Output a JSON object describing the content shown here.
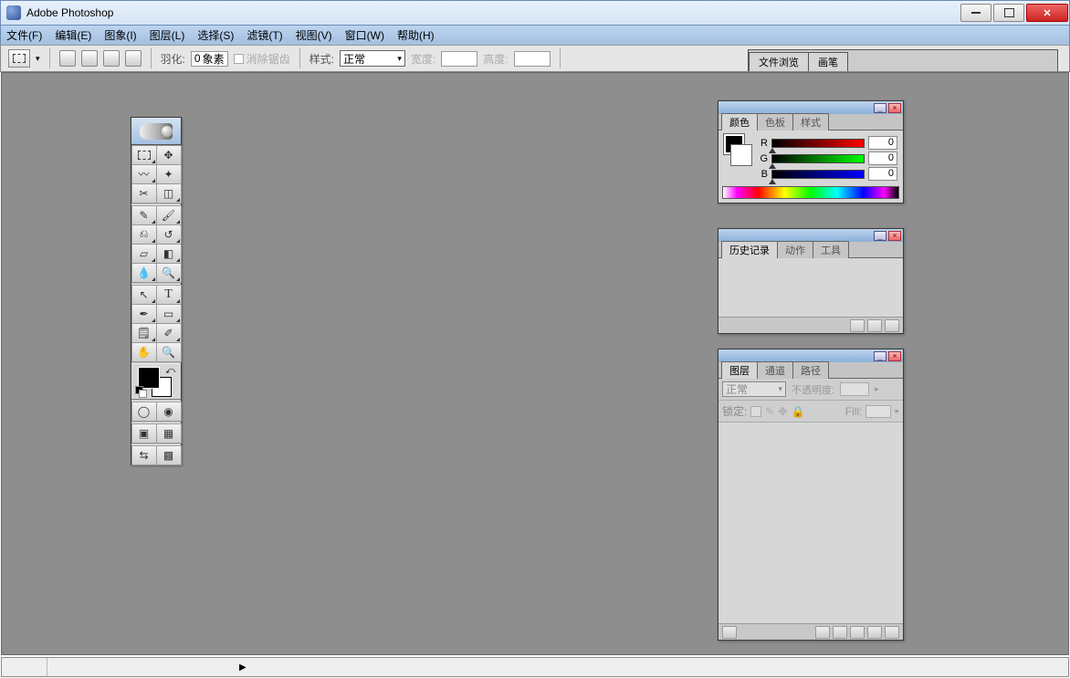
{
  "window": {
    "title": "Adobe Photoshop"
  },
  "menu": {
    "file": "文件(F)",
    "edit": "编辑(E)",
    "image": "图象(I)",
    "layer": "图层(L)",
    "select": "选择(S)",
    "filter": "滤镜(T)",
    "view": "视图(V)",
    "window": "窗口(W)",
    "help": "帮助(H)"
  },
  "options": {
    "feather_label": "羽化:",
    "feather_value": "0",
    "feather_unit": "象素",
    "antialias": "消除锯齿",
    "style_label": "样式:",
    "style_value": "正常",
    "width_label": "宽度:",
    "width_value": "",
    "height_label": "高度:",
    "height_value": ""
  },
  "dock": {
    "tab1": "文件浏览",
    "tab2": "画笔"
  },
  "color_panel": {
    "tabs": {
      "color": "颜色",
      "swatches": "色板",
      "styles": "样式"
    },
    "r_label": "R",
    "r_value": "0",
    "g_label": "G",
    "g_value": "0",
    "b_label": "B",
    "b_value": "0"
  },
  "history_panel": {
    "tabs": {
      "history": "历史记录",
      "actions": "动作",
      "tools": "工具"
    }
  },
  "layers_panel": {
    "tabs": {
      "layers": "图层",
      "channels": "通道",
      "paths": "路径"
    },
    "blend_mode": "正常",
    "opacity_label": "不透明度:",
    "lock_label": "锁定:",
    "fill_label": "Fill:"
  },
  "toolbox": {
    "tools": [
      "marquee",
      "move",
      "lasso",
      "wand",
      "crop",
      "slice",
      "healing",
      "brush",
      "stamp",
      "history-brush",
      "eraser",
      "gradient",
      "blur",
      "dodge",
      "path-select",
      "type",
      "pen",
      "shape",
      "notes",
      "eyedropper",
      "hand",
      "zoom"
    ]
  }
}
